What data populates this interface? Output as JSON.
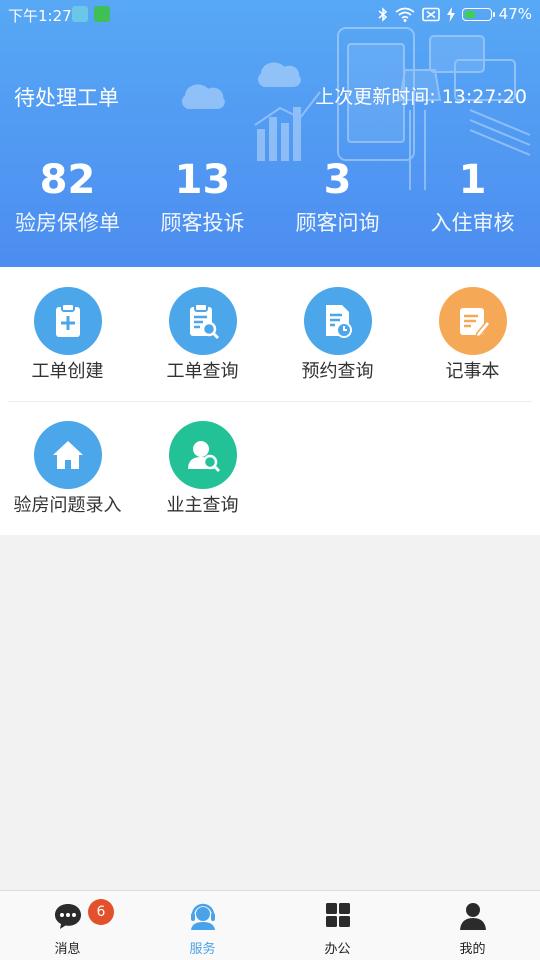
{
  "status_bar": {
    "time": "下午1:27",
    "battery": "47%",
    "battery_level": 0.47
  },
  "header": {
    "title": "待处理工单",
    "last_update": "上次更新时间: 13:27:20"
  },
  "stats": [
    {
      "value": "82",
      "label": "验房保修单"
    },
    {
      "value": "13",
      "label": "顾客投诉"
    },
    {
      "value": "3",
      "label": "顾客问询"
    },
    {
      "value": "1",
      "label": "入住审核"
    }
  ],
  "grid_items": [
    {
      "label": "工单创建",
      "icon": "clipboard-plus-icon",
      "color": "#4ba6ea"
    },
    {
      "label": "工单查询",
      "icon": "clipboard-search-icon",
      "color": "#4ba6ea"
    },
    {
      "label": "预约查询",
      "icon": "document-clock-icon",
      "color": "#4ba6ea"
    },
    {
      "label": "记事本",
      "icon": "notepad-pen-icon",
      "color": "#f5a956"
    },
    {
      "label": "验房问题录入",
      "icon": "house-icon",
      "color": "#4ba6ea"
    },
    {
      "label": "业主查询",
      "icon": "person-search-icon",
      "color": "#22c196"
    }
  ],
  "tabbar": {
    "tabs": [
      {
        "label": "消息",
        "icon": "chat-icon",
        "badge": "6"
      },
      {
        "label": "服务",
        "icon": "headset-icon"
      },
      {
        "label": "办公",
        "icon": "grid-icon"
      },
      {
        "label": "我的",
        "icon": "person-icon"
      }
    ],
    "active_tab": "服务",
    "active_color": "#4aa3e8"
  }
}
